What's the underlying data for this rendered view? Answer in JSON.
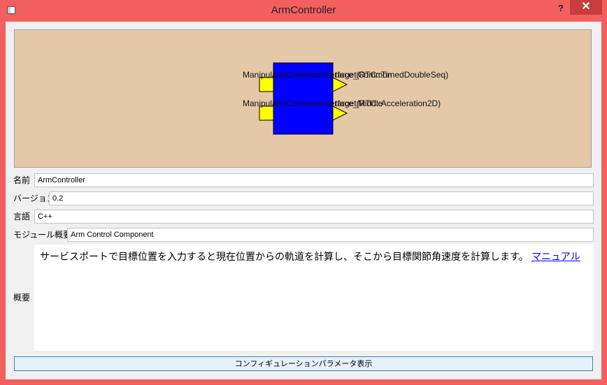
{
  "window": {
    "title": "ArmController",
    "help_label": "?",
    "close_label": "✕"
  },
  "component": {
    "inports": [
      {
        "label": "ManipulatorCommonInterface_Common"
      },
      {
        "label": "ManipulatorCommonInterface_Middle"
      }
    ],
    "outports": [
      {
        "label": "target(RTC::TimedDoubleSeq)"
      },
      {
        "label": "target(RTC::Acceleration2D)"
      }
    ],
    "colors": {
      "body": "#0000ff",
      "port": "#ffff00",
      "canvas": "#e5c8a8"
    }
  },
  "fields": {
    "name": {
      "label": "名前",
      "value": "ArmController"
    },
    "version": {
      "label": "バージョン",
      "value": "0.2"
    },
    "language": {
      "label": "言語",
      "value": "C++"
    },
    "module_desc": {
      "label": "モジュール概要",
      "value": "Arm Control Component"
    },
    "overview": {
      "label": "概要",
      "text": "サービスポートで目標位置を入力すると現在位置からの軌道を計算し、そこから目標関節角速度を計算します。",
      "link": "マニュアル"
    }
  },
  "buttons": {
    "config": "コンフィギュレーションパラメータ表示"
  }
}
